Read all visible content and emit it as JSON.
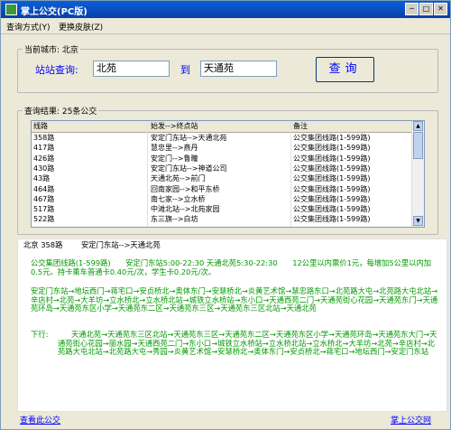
{
  "window": {
    "title": "掌上公交(PC版)"
  },
  "menu": [
    "查询方式(Y)",
    "更换皮肤(Z)"
  ],
  "city": {
    "label": "当前城市: 北京"
  },
  "search": {
    "label": "站站查询:",
    "from": "北苑",
    "to_label": "到",
    "to": "天通苑",
    "button": "查询"
  },
  "results": {
    "legend": "查询结果: 25条公交",
    "columns": [
      "线路",
      "始发-->终点站",
      "备注"
    ],
    "rows": [
      [
        "358路",
        "安定门东站-->天通北苑",
        "公交集团线路(1-599路)"
      ],
      [
        "417路",
        "慧忠里-->燕丹",
        "公交集团线路(1-599路)"
      ],
      [
        "426路",
        "安定门-->鲁疃",
        "公交集团线路(1-599路)"
      ],
      [
        "430路",
        "安定门东站-->神道公司",
        "公交集团线路(1-599路)"
      ],
      [
        "43路",
        "天通北苑-->前门",
        "公交集团线路(1-599路)"
      ],
      [
        "464路",
        "回南家园-->和平东桥",
        "公交集团线路(1-599路)"
      ],
      [
        "467路",
        "南七家-->立水桥",
        "公交集团线路(1-599路)"
      ],
      [
        "517路",
        "中滩北站-->北苑家园",
        "公交集团线路(1-599路)"
      ],
      [
        "522路",
        "东三旗-->白坊",
        "公交集团线路(1-599路)"
      ]
    ]
  },
  "detail": {
    "header_city": "北京 358路",
    "header_route": "安定门东站-->天通北苑",
    "info": "公交集团线路(1-599路)　　安定门东站5:00-22:30 天通北苑5:30-22:30　　12公里以内票价1元，每增加5公里以内加0.5元。持卡乘车普通卡0.40元/次，学生卡0.20元/次。",
    "up": "安定门东站→地坛西门→蒋宅口→安贞桥北→奥体东门→安慧桥北→炎黄艺术馆→慧忠路东口→北苑路大屯→北苑路大屯北站→辛店村→北苑→大羊坊→立水桥北→立水桥北站→城铁立水桥站→东小口→天通西苑二门→天通苑街心花园→天通苑东门→天通苑环岛→天通苑东区小学→天通苑东二区→天通苑东三区→天通苑东三区北站→天通北苑",
    "down_label": "下行:",
    "down": "天通北苑→天通苑东三区北站→天通苑东三区→天通苑东二区→天通苑东区小学→天通苑环岛→天通苑东大门→天通苑街心花园→丽水园→天通西苑二门→东小口→城铁立水桥站→立水桥北站→立水桥北→大羊坊→北苑→辛店村→北苑路大屯北站→北苑路大屯→秀园→炎黄艺术馆→安慧桥北→奥体东门→安贞桥北→蒋宅口→地坛西门→安定门东站"
  },
  "footer": {
    "left_link": "查看此公交",
    "right_link": "掌上公交网"
  }
}
